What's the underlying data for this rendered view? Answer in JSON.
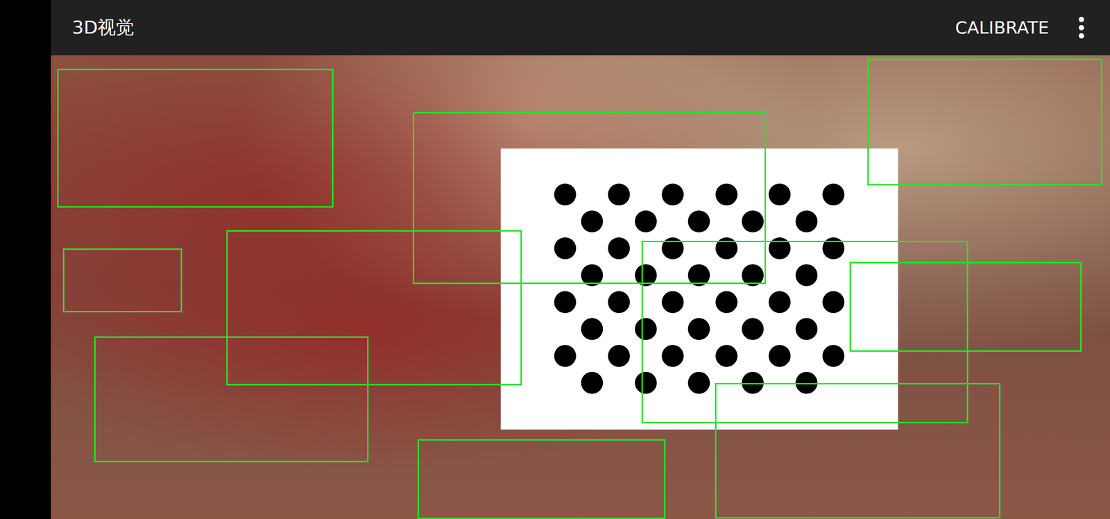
{
  "app_bar": {
    "title": "3D视觉",
    "action": "CALIBRATE"
  }
}
